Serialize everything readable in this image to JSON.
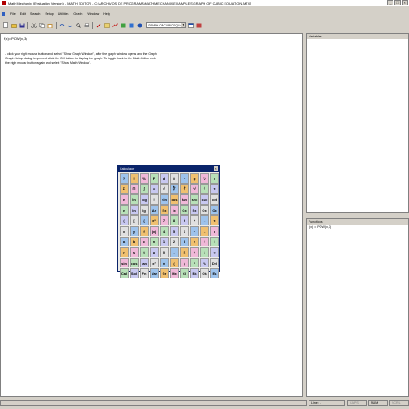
{
  "window": {
    "title": "Math Mechanix (Evaluation Version) - [MATH EDITOR - C:\\ARCHIVOS DE PROGRAMA\\MATHMECHANIX\\EXAMPLES\\GRAPH OF CUBIC EQUATION.MTX]",
    "minimize": "_",
    "maximize": "□",
    "close": "×"
  },
  "menu": [
    "File",
    "Edit",
    "Search",
    "Setup",
    "Utilities",
    "Graph",
    "Window",
    "Help"
  ],
  "toolbar": {
    "combo_value": "GRAPH OF CUBIC EQUA",
    "icons": [
      "new-file-icon",
      "open-folder-icon",
      "save-icon",
      "cut-icon",
      "copy-icon",
      "paste-icon",
      "undo-icon",
      "redo-icon",
      "find-icon",
      "print-icon",
      "edit-icon",
      "calculator-icon",
      "graph-icon",
      "matrix-icon",
      "function-icon",
      "help-icon",
      "window-icon",
      "equation-icon"
    ]
  },
  "editor": {
    "formula": "f(x)=POW(x,3)",
    "instructions": [
      "- click your right mouse button and select \"Show Graph Window\", after the graph window opens and the Graph",
      "  Graph Setup dialog is opened, click the OK button to display the graph. To toggle back to the Math Editor click",
      "  the right mouse button again and select \"Show Math Window\"."
    ]
  },
  "variables": {
    "header": "Variables"
  },
  "functions": {
    "header": "Functions",
    "items": [
      "f(x) = POW(x,3)"
    ]
  },
  "status": {
    "line": "Line: 1",
    "caps": "CAPS",
    "num": "NUM",
    "scrl": "SCRL"
  },
  "calculator": {
    "title": "Calculator",
    "close": "×",
    "keys": [
      [
        "?",
        "!",
        "%",
        "F",
        "d",
        "#",
        "~",
        "φ",
        "↻",
        "x"
      ],
      [
        "Σ",
        "Π",
        "∫",
        "=",
        "√",
        "∛",
        "∜",
        "ⁿ√",
        "√",
        "π"
      ],
      [
        "e",
        "ln",
        "log",
        "!",
        "sin",
        "cos",
        "tan",
        "sec",
        "csc",
        "cot"
      ],
      [
        "e",
        "ln",
        "lg",
        "Ar",
        "Ex",
        "Ix",
        "Gx",
        "Sx",
        "Ox",
        "Ox"
      ],
      [
        "(",
        "[",
        "{",
        "xˣ",
        "7",
        "8",
        "9",
        "+",
        "←",
        "π"
      ],
      [
        "x",
        "y",
        "f",
        "|x|",
        "4",
        "5",
        "6",
        "−",
        "→",
        "e"
      ],
      [
        "a",
        "b",
        "c",
        "n",
        "1",
        "2",
        "3",
        "×",
        "↑",
        "i"
      ],
      [
        "r",
        "s",
        "t",
        "u",
        "0",
        ".",
        "E",
        "÷",
        "↓",
        "∞"
      ],
      [
        "sin",
        "cos",
        "tan",
        "x²",
        "±",
        "(",
        ")",
        "^",
        "%",
        "Del"
      ],
      [
        "Cal",
        "Sol",
        "Fn",
        "Var",
        "Gr",
        "Mx",
        "Cl",
        "Bk",
        "Ok",
        "Es"
      ]
    ]
  }
}
